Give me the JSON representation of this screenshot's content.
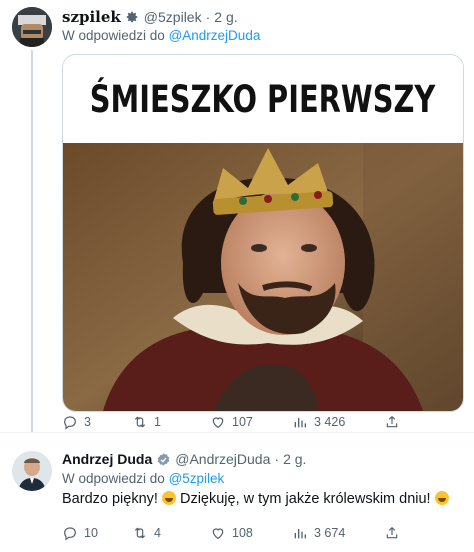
{
  "tweets": [
    {
      "author": {
        "name": "szpilek",
        "handle": "@5zpilek",
        "time": "2 g."
      },
      "reply_to": {
        "prefix": "W odpowiedzi do",
        "handle": "@AndrzejDuda"
      },
      "media": {
        "title": "ŚMIESZKO PIERWSZY"
      },
      "stats": {
        "replies": "3",
        "retweets": "1",
        "likes": "107",
        "views": "3 426"
      }
    },
    {
      "author": {
        "name": "Andrzej Duda",
        "handle": "@AndrzejDuda",
        "time": "2 g."
      },
      "reply_to": {
        "prefix": "W odpowiedzi do",
        "handle": "@5zpilek"
      },
      "text_before": "Bardzo piękny!",
      "text_after": "Dziękuję, w tym jakże królewskim dniu!",
      "stats": {
        "replies": "10",
        "retweets": "4",
        "likes": "108",
        "views": "3 674"
      }
    }
  ],
  "colors": {
    "link": "#1d9bf0",
    "muted": "#536471",
    "verified": "#829aab"
  },
  "icons": [
    "reply-icon",
    "retweet-icon",
    "like-icon",
    "views-icon",
    "share-icon",
    "gear-icon",
    "verified-badge-icon"
  ]
}
